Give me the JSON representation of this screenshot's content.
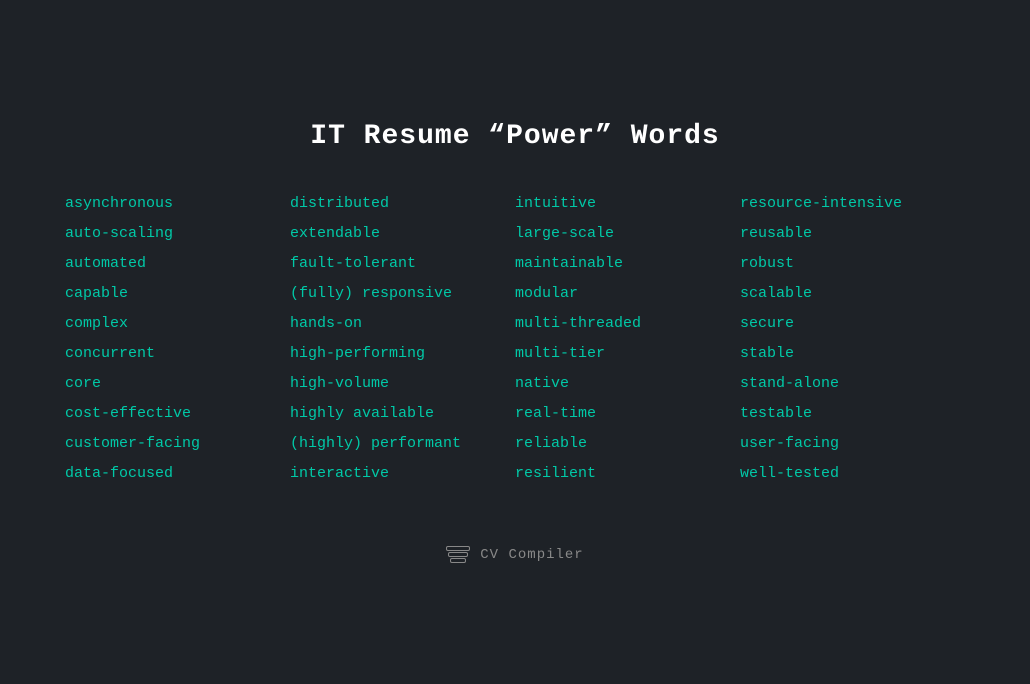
{
  "title": "IT Resume “Power” Words",
  "columns": [
    {
      "id": "col1",
      "words": [
        "asynchronous",
        "auto-scaling",
        "automated",
        "capable",
        "complex",
        "concurrent",
        "core",
        "cost-effective",
        "customer-facing",
        "data-focused"
      ]
    },
    {
      "id": "col2",
      "words": [
        "distributed",
        "extendable",
        "fault-tolerant",
        "(fully) responsive",
        "hands-on",
        "high-performing",
        "high-volume",
        "highly available",
        "(highly) performant",
        "interactive"
      ]
    },
    {
      "id": "col3",
      "words": [
        "intuitive",
        "large-scale",
        "maintainable",
        "modular",
        "multi-threaded",
        "multi-tier",
        "native",
        "real-time",
        "reliable",
        "resilient"
      ]
    },
    {
      "id": "col4",
      "words": [
        "resource-intensive",
        "reusable",
        "robust",
        "scalable",
        "secure",
        "stable",
        "stand-alone",
        "testable",
        "user-facing",
        "well-tested"
      ]
    }
  ],
  "footer": {
    "brand": "CV Compiler",
    "icon": "stack"
  }
}
